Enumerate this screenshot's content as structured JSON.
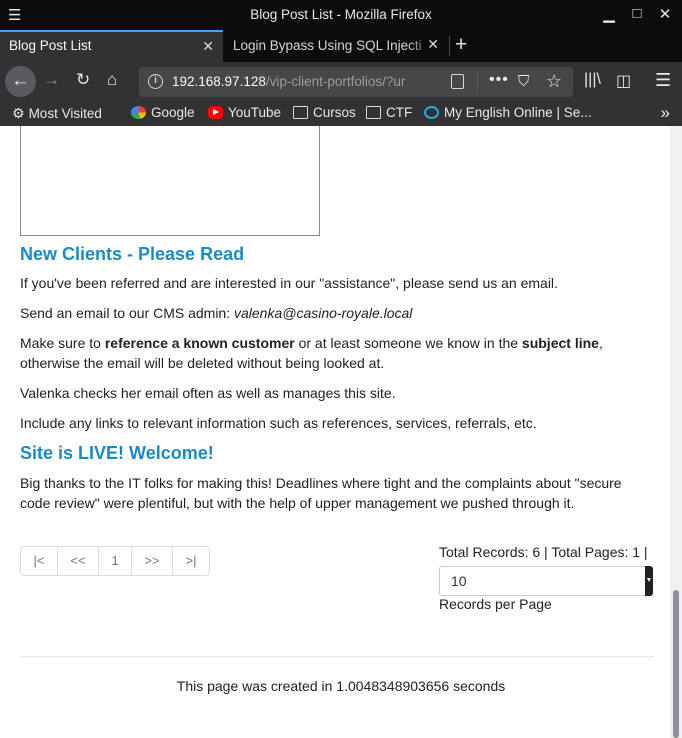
{
  "window": {
    "title": "Blog Post List - Mozilla Firefox"
  },
  "tabs": [
    {
      "label": "Blog Post List",
      "active": true
    },
    {
      "label": "Login Bypass Using SQL Injecti",
      "active": false
    }
  ],
  "urlbar": {
    "host": "192.168.97.128",
    "path": "/vip-client-portfolios/?ur"
  },
  "bookmarks": [
    {
      "label": "Most Visited",
      "icon": "gear-icon"
    },
    {
      "label": "Google",
      "icon": "google-icon"
    },
    {
      "label": "YouTube",
      "icon": "youtube-icon"
    },
    {
      "label": "Cursos",
      "icon": "folder-icon"
    },
    {
      "label": "CTF",
      "icon": "folder-icon"
    },
    {
      "label": "My English Online | Se...",
      "icon": "english-online-icon"
    }
  ],
  "posts": [
    {
      "title": "New Clients - Please Read",
      "paragraphs": {
        "p1": "If you've been referred and are interested in our \"assistance\", please send us an email.",
        "p2_prefix": "Send an email to our CMS admin: ",
        "p2_email": "valenka@casino-royale.local",
        "p3_a": "Make sure to ",
        "p3_bold1": "reference a known customer",
        "p3_b": " or at least someone we know in the ",
        "p3_bold2": "subject line",
        "p3_c": ", otherwise the email will be deleted without being looked at.",
        "p4": "Valenka checks her email often as well as manages this site.",
        "p5": "Include any links to relevant information such as references, services, referrals, etc."
      }
    },
    {
      "title": "Site is LIVE! Welcome!",
      "paragraphs": {
        "p1": "Big thanks to the IT folks for making this! Deadlines where tight and the complaints about \"secure code review\" were plentiful, but with the help of upper management we pushed through it."
      }
    }
  ],
  "pagination": {
    "first": "|<",
    "prev": "<<",
    "current": "1",
    "next": ">>",
    "last": ">|"
  },
  "records": {
    "summary": "Total Records: 6 | Total Pages: 1 |",
    "per_page_value": "10",
    "per_page_label": "Records per Page"
  },
  "footer": {
    "text": "This page was created in 1.0048348903656 seconds"
  },
  "colors": {
    "heading": "#1a8bc6",
    "chrome_dark": "#0c0c0d",
    "toolbar": "#323234",
    "tab_accent": "#45a1ff"
  }
}
